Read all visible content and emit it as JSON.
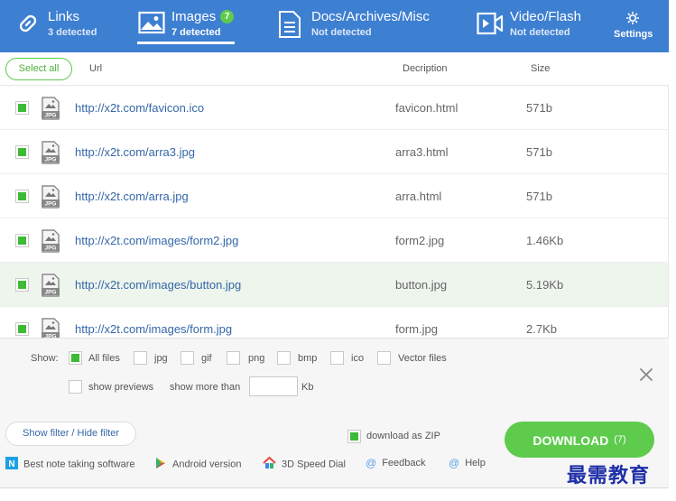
{
  "tabs": [
    {
      "id": "links",
      "title": "Links",
      "subtitle": "3 detected",
      "icon": "link-icon"
    },
    {
      "id": "images",
      "title": "Images",
      "subtitle": "7 detected",
      "badge": "7",
      "icon": "image-icon",
      "active": true
    },
    {
      "id": "docs",
      "title": "Docs/Archives/Misc",
      "subtitle": "Not detected",
      "icon": "document-icon"
    },
    {
      "id": "video",
      "title": "Video/Flash",
      "subtitle": "Not detected",
      "icon": "video-icon"
    }
  ],
  "settings": {
    "label": "Settings",
    "icon": "gear-icon"
  },
  "columns": {
    "select_all": "Select all",
    "url": "Url",
    "description": "Decription",
    "size": "Size"
  },
  "files": [
    {
      "checked": true,
      "type": "JPG",
      "url": "http://x2t.com/favicon.ico",
      "description": "favicon.html",
      "size": "571b"
    },
    {
      "checked": true,
      "type": "JPG",
      "url": "http://x2t.com/arra3.jpg",
      "description": "arra3.html",
      "size": "571b"
    },
    {
      "checked": true,
      "type": "JPG",
      "url": "http://x2t.com/arra.jpg",
      "description": "arra.html",
      "size": "571b"
    },
    {
      "checked": true,
      "type": "JPG",
      "url": "http://x2t.com/images/form2.jpg",
      "description": "form2.jpg",
      "size": "1.46Kb"
    },
    {
      "checked": true,
      "type": "JPG",
      "url": "http://x2t.com/images/button.jpg",
      "description": "button.jpg",
      "size": "5.19Kb",
      "highlighted": true
    },
    {
      "checked": true,
      "type": "JPG",
      "url": "http://x2t.com/images/form.jpg",
      "description": "form.jpg",
      "size": "2.7Kb"
    }
  ],
  "filter": {
    "show_label": "Show:",
    "types": [
      {
        "label": "All files",
        "checked": true
      },
      {
        "label": "jpg",
        "checked": false
      },
      {
        "label": "gif",
        "checked": false
      },
      {
        "label": "png",
        "checked": false
      },
      {
        "label": "bmp",
        "checked": false
      },
      {
        "label": "ico",
        "checked": false
      },
      {
        "label": "Vector files",
        "checked": false
      }
    ],
    "show_previews": {
      "label": "show previews",
      "checked": false
    },
    "show_more_than": "show more than",
    "kb_value": "",
    "kb_unit": "Kb"
  },
  "bottom": {
    "filter_toggle": "Show filter / Hide filter",
    "zip": {
      "label": "download as ZIP",
      "checked": true
    },
    "download": {
      "label": "DOWNLOAD",
      "count": "(7)"
    }
  },
  "footer_links": [
    {
      "label": "Best note taking software",
      "icon": "note-app-icon"
    },
    {
      "label": "Android version",
      "icon": "play-store-icon"
    },
    {
      "label": "3D Speed Dial",
      "icon": "house-icon"
    },
    {
      "label": "Feedback",
      "icon": "at-icon"
    },
    {
      "label": "Help",
      "icon": "at-icon"
    }
  ],
  "watermark": "最需教育",
  "colors": {
    "header": "#3d7fd1",
    "accent_green": "#5ecb4d",
    "check_green": "#3dba36",
    "link_blue": "#3567a8",
    "highlight_row": "#edf5ec"
  }
}
